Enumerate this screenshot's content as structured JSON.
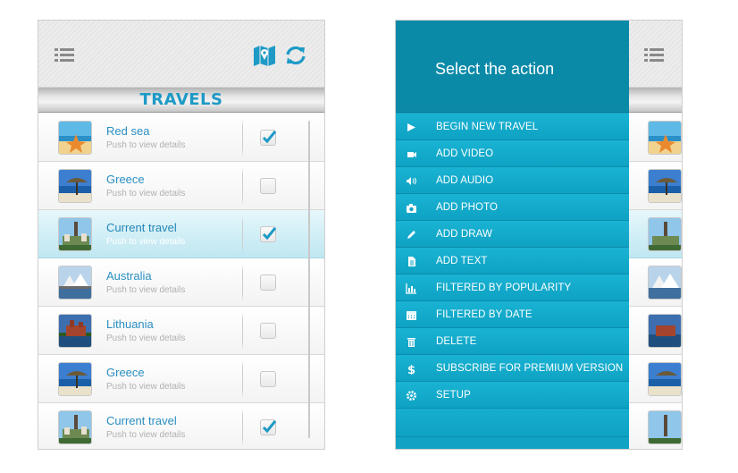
{
  "left_screen": {
    "title": "TRAVELS",
    "rows": [
      {
        "title": "Red sea",
        "subtitle": "Push to view details",
        "checked": true,
        "active": false,
        "thumb": "beach-starfish"
      },
      {
        "title": "Greece",
        "subtitle": "Push to view details",
        "checked": false,
        "active": false,
        "thumb": "beach-umbrella"
      },
      {
        "title": "Current travel",
        "subtitle": "Push to view details",
        "checked": true,
        "active": true,
        "thumb": "city-tower"
      },
      {
        "title": "Australia",
        "subtitle": "Push to view details",
        "checked": false,
        "active": false,
        "thumb": "harbour"
      },
      {
        "title": "Lithuania",
        "subtitle": "Push to view details",
        "checked": false,
        "active": false,
        "thumb": "castle"
      },
      {
        "title": "Greece",
        "subtitle": "Push to view details",
        "checked": false,
        "active": false,
        "thumb": "beach-umbrella"
      },
      {
        "title": "Current travel",
        "subtitle": "Push to view details",
        "checked": true,
        "active": false,
        "thumb": "city-tower"
      }
    ]
  },
  "right_screen": {
    "menu_title": "Select the action",
    "items": [
      {
        "label": "BEGIN NEW TRAVEL",
        "icon": "play-icon"
      },
      {
        "label": "ADD VIDEO",
        "icon": "video-icon"
      },
      {
        "label": "ADD AUDIO",
        "icon": "speaker-icon"
      },
      {
        "label": "ADD PHOTO",
        "icon": "camera-icon"
      },
      {
        "label": "ADD DRAW",
        "icon": "pencil-icon"
      },
      {
        "label": "ADD TEXT",
        "icon": "document-icon"
      },
      {
        "label": "FILTERED BY POPULARITY",
        "icon": "bar-chart-icon"
      },
      {
        "label": "FILTERED BY DATE",
        "icon": "calendar-icon"
      },
      {
        "label": "DELETE",
        "icon": "trash-icon"
      },
      {
        "label": "SUBSCRIBE FOR PREMIUM VERSION",
        "icon": "dollar-icon"
      },
      {
        "label": "SETUP",
        "icon": "gear-icon"
      }
    ]
  },
  "colors": {
    "accent": "#1d9ac6",
    "menu_bg": "#12a3c4",
    "menu_header": "#0b8aa8"
  }
}
